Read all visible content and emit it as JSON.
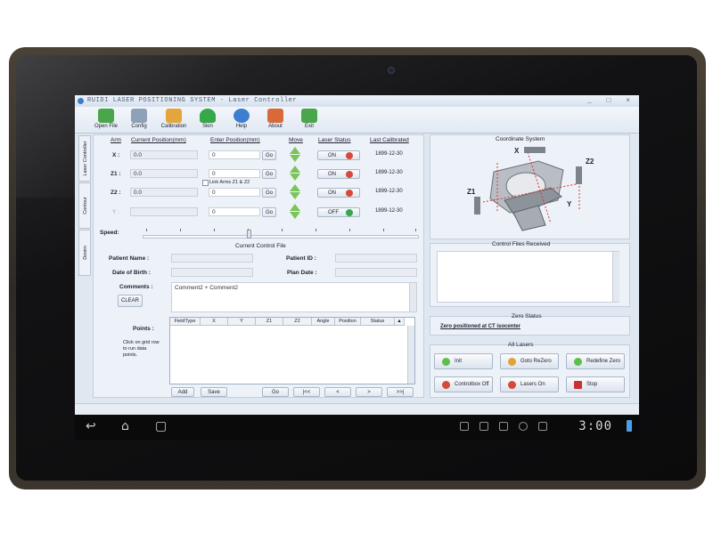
{
  "window": {
    "title": "RUIDI LASER POSITIONING SYSTEM - Laser Controller",
    "controls": "_ □ ×"
  },
  "toolbar": [
    {
      "label": "Open File",
      "icon": "open-file-icon",
      "color": "#4aa64a"
    },
    {
      "label": "Config",
      "icon": "config-icon",
      "color": "#8ea1b8"
    },
    {
      "label": "Calibration",
      "icon": "calibration-icon",
      "color": "#e3a53c"
    },
    {
      "label": "Skin",
      "icon": "skin-icon",
      "color": "#35a84a"
    },
    {
      "label": "Help",
      "icon": "help-icon",
      "color": "#3c7ed0"
    },
    {
      "label": "About",
      "icon": "about-icon",
      "color": "#d86a3a"
    },
    {
      "label": "Exit",
      "icon": "exit-icon",
      "color": "#4aa64a"
    }
  ],
  "side_tabs": [
    "Laser Controller",
    "Contour",
    "Dosim"
  ],
  "laser_table": {
    "headers": {
      "arm": "Arm",
      "current": "Current Position(mm)",
      "enter": "Enter Position(mm)",
      "move": "Move",
      "status": "Laser Status",
      "calibrated": "Last Calibrated"
    },
    "rows": [
      {
        "arm": "X :",
        "current": "0.0",
        "enter": "0",
        "go": "Go",
        "status": "ON",
        "calibrated": "1899-12-30"
      },
      {
        "arm": "Z1 :",
        "current": "0.0",
        "enter": "0",
        "go": "Go",
        "status": "ON",
        "calibrated": "1899-12-30"
      },
      {
        "arm": "Z2 :",
        "current": "0.0",
        "enter": "0",
        "go": "Go",
        "status": "ON",
        "calibrated": "1899-12-30"
      },
      {
        "arm": "Y :",
        "current": "",
        "enter": "0",
        "go": "Go",
        "status": "OFF",
        "calibrated": "1899-12-30"
      }
    ],
    "link_label": "Link Arms Z1 & Z2",
    "speed_label": "Speed:"
  },
  "control_file": {
    "title": "Current Control File",
    "patient_name_label": "Patient Name :",
    "patient_id_label": "Patient  ID :",
    "dob_label": "Date of Birth :",
    "plan_date_label": "Plan Date :",
    "comments_label": "Comments :",
    "comments_value": "Comment2 + Comment2",
    "clear_label": "CLEAR",
    "points_label": "Points :",
    "points_hint": "Click on grid row to run data points.",
    "grid_headers": [
      "FieldType",
      "X",
      "Y",
      "Z1",
      "Z2",
      "Angle",
      "Position",
      "Status",
      "▲"
    ],
    "buttons": {
      "add": "Add",
      "save": "Save",
      "go": "Go",
      "first": "|<<",
      "prev": "<",
      "next": ">",
      "last": ">>|"
    }
  },
  "coordinate_system": {
    "title": "Coordinate System",
    "axes": [
      "X",
      "Z2",
      "Z1",
      "Y"
    ]
  },
  "control_files_received": {
    "title": "Control Files Received"
  },
  "zero_status": {
    "title": "Zero Status",
    "value": "Zero positioned at CT isocenter"
  },
  "all_lasers": {
    "title": "All Lasers",
    "buttons": [
      {
        "label": "Init",
        "color": "#5cbf4a"
      },
      {
        "label": "Goto ReZero",
        "color": "#e0a334"
      },
      {
        "label": "Redefine Zero",
        "color": "#5cbf4a"
      },
      {
        "label": "Controlbox Off",
        "color": "#d64a3a"
      },
      {
        "label": "Lasers On",
        "color": "#d64a3a"
      },
      {
        "label": "Stop",
        "color": "#c93232"
      }
    ]
  },
  "android": {
    "clock": "3:00"
  }
}
